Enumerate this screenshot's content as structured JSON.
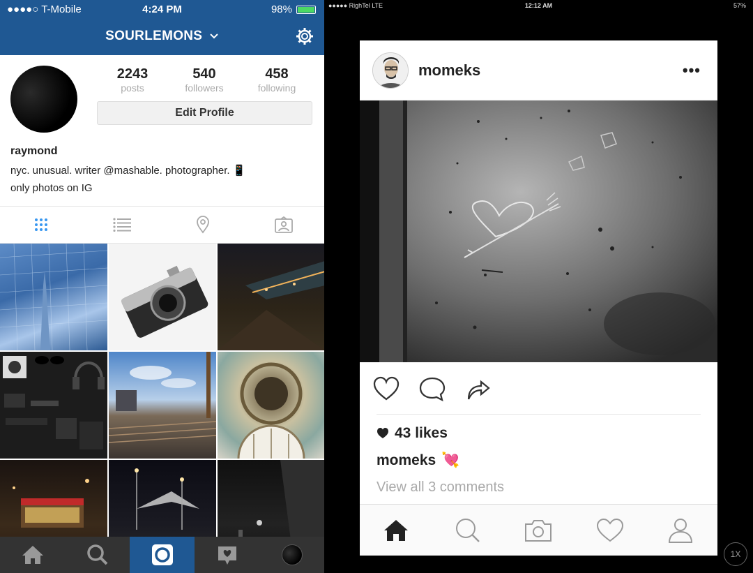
{
  "left_phone": {
    "status": {
      "carrier": "●●●●○ T-Mobile",
      "time": "4:24 PM",
      "battery": "98%",
      "battery_level": 0.98
    },
    "nav": {
      "username": "SOURLEMONS"
    },
    "profile": {
      "stats": [
        {
          "value": "2243",
          "label": "posts"
        },
        {
          "value": "540",
          "label": "followers"
        },
        {
          "value": "458",
          "label": "following"
        }
      ],
      "edit_label": "Edit Profile",
      "name": "raymond",
      "bio_line1": "nyc. unusual. writer @mashable. photographer. 📱",
      "bio_line2": "only photos on IG"
    },
    "tabs": [
      "grid-icon",
      "list-icon",
      "location-icon",
      "tagged-icon"
    ],
    "bottom_tabs": [
      "home-icon",
      "search-icon",
      "camera-icon",
      "activity-icon",
      "profile-icon"
    ]
  },
  "right_phone": {
    "status": {
      "carrier": "●●●●● RighTel  LTE",
      "time": "12:12 AM",
      "battery": "57%"
    },
    "post": {
      "username": "momeks",
      "more": "•••",
      "likes": "43 likes",
      "caption_user": "momeks",
      "caption_emoji": "💘",
      "comments": "View all 3 comments"
    },
    "bottom_tabs": [
      "home-icon",
      "search-icon",
      "camera-icon",
      "heart-icon",
      "profile-icon"
    ],
    "zoom": "1X"
  },
  "colors": {
    "ig_blue": "#1f5893",
    "tab_active": "#3897f0",
    "bar_dark": "#333333"
  }
}
